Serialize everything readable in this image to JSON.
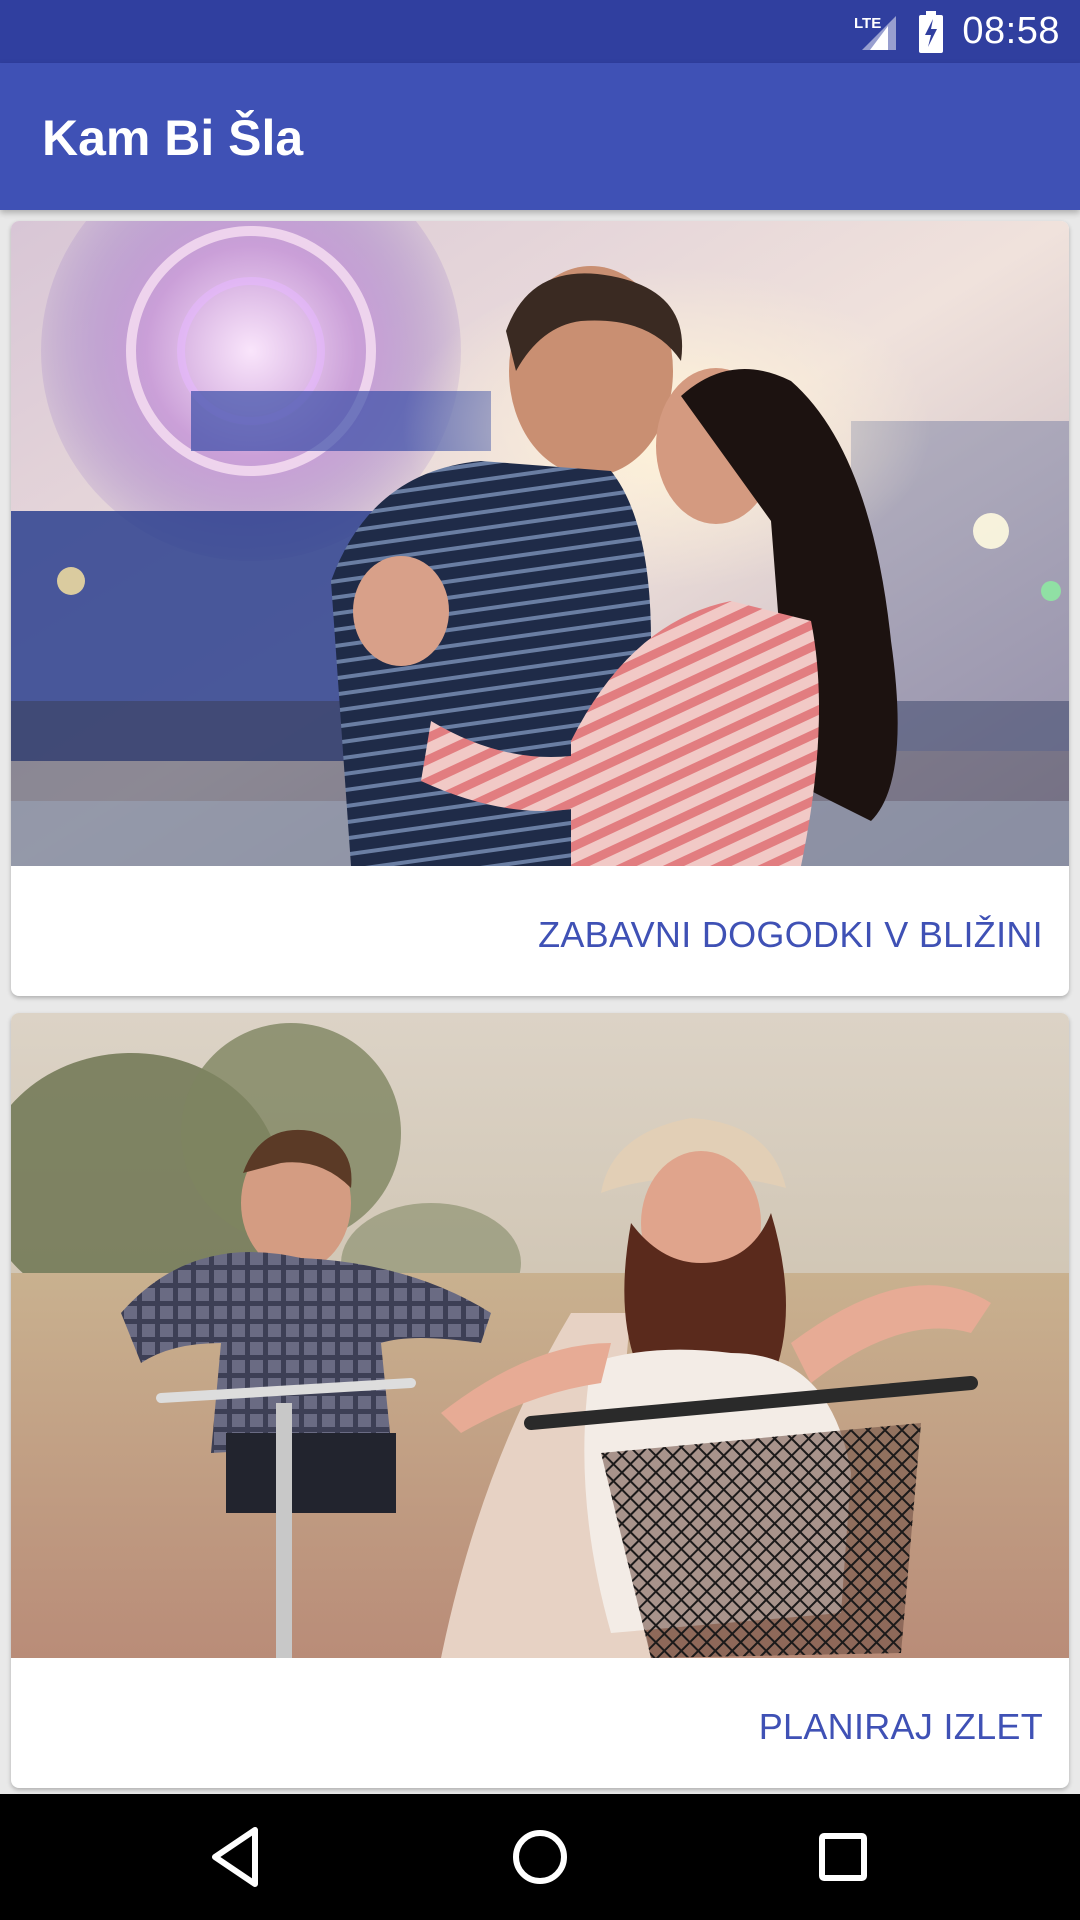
{
  "status_bar": {
    "time": "08:58",
    "network_label": "LTE",
    "icons": [
      "lte-signal-icon",
      "battery-charging-icon"
    ]
  },
  "app_bar": {
    "title": "Kam Bi Šla"
  },
  "cards": [
    {
      "image": "couple-embrace-at-fair-photo",
      "action_label": "ZABAVNI DOGODKI V BLIŽINI"
    },
    {
      "image": "couple-riding-bicycles-photo",
      "action_label": "PLANIRAJ IZLET"
    }
  ],
  "nav_bar": {
    "icons": [
      "back-icon",
      "home-icon",
      "recents-icon"
    ]
  },
  "colors": {
    "status_bar": "#303f9f",
    "app_bar": "#3f51b5",
    "accent_text": "#3f51b5",
    "background": "#e9e9e9"
  }
}
